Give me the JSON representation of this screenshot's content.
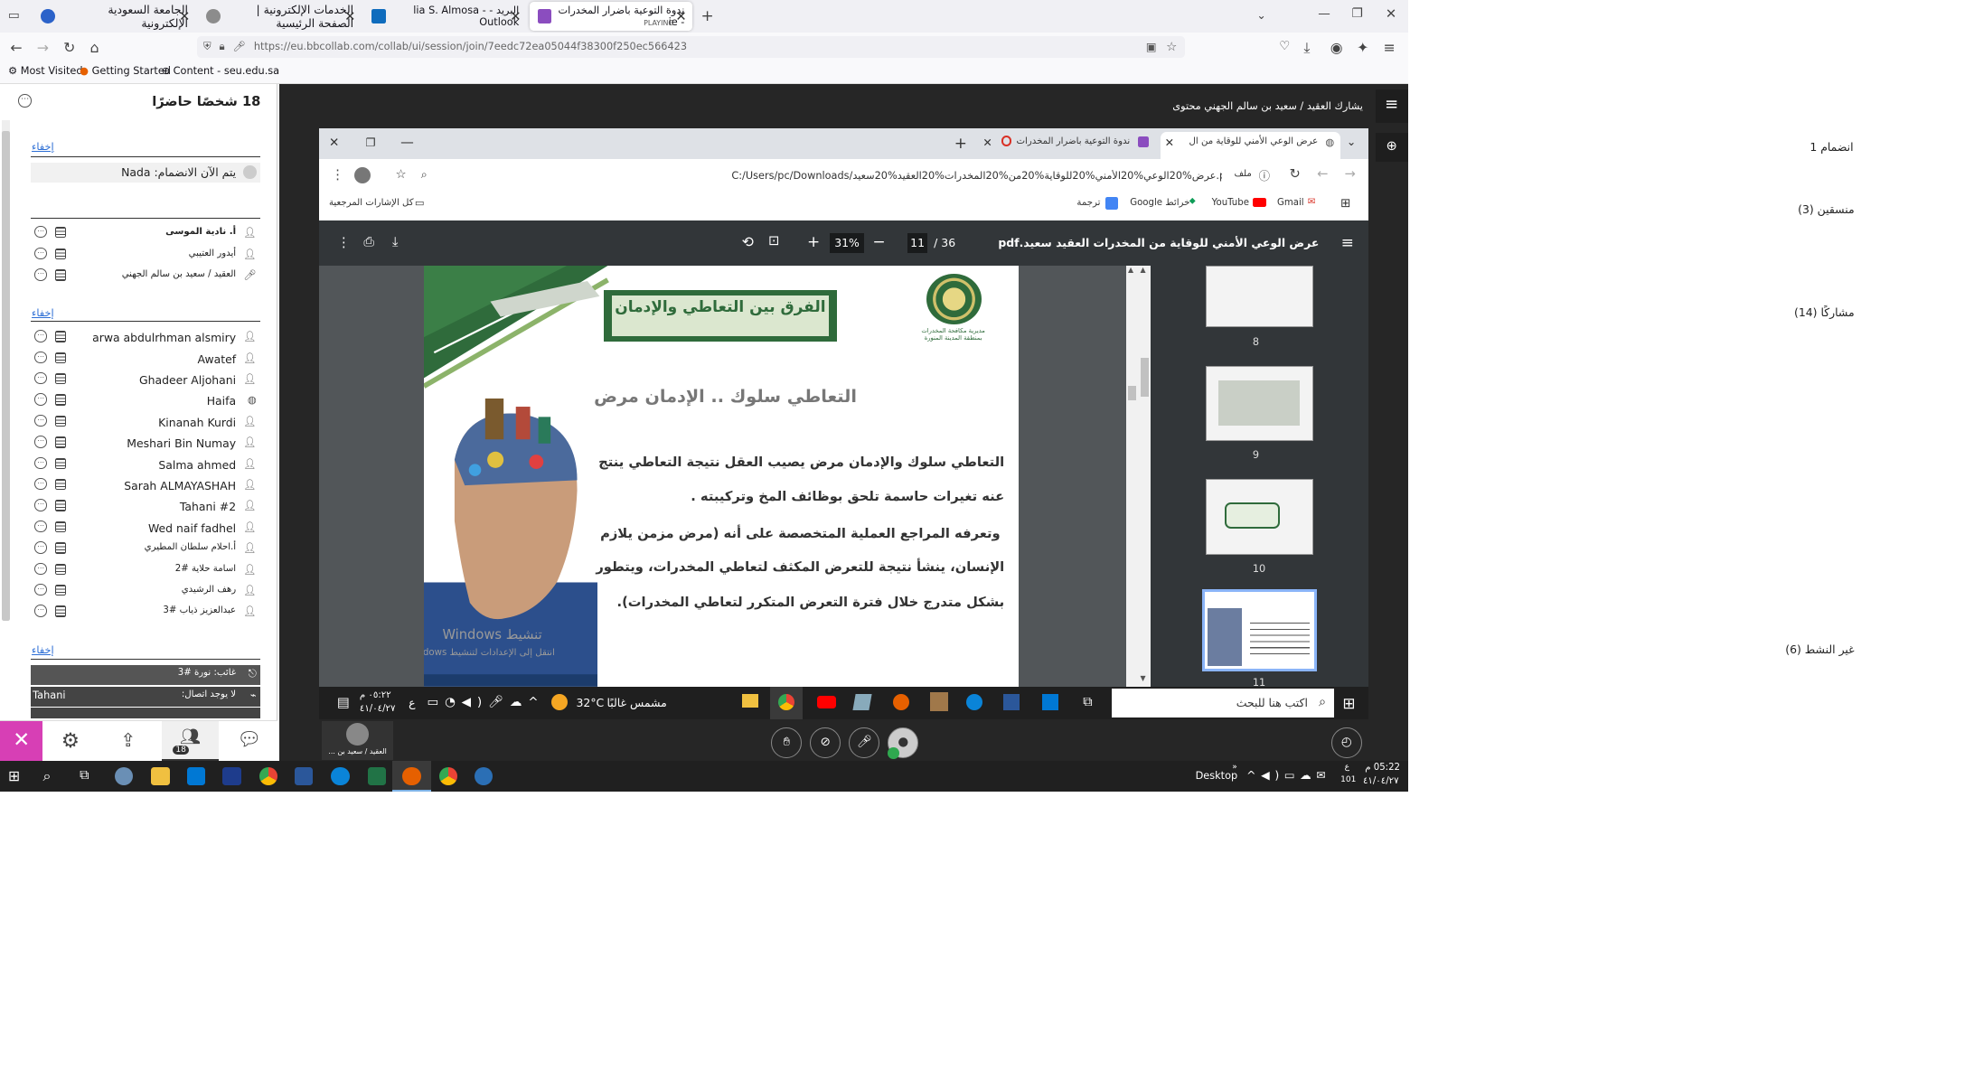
{
  "browser": {
    "tabs": [
      {
        "title": "الجامعة السعودية الإلكترونية",
        "active": false
      },
      {
        "title": "الخدمات الإلكترونية | الصفحة الرئيسية",
        "active": false
      },
      {
        "title": "البريد - lia S. Almosa - Outlook",
        "active": false
      },
      {
        "title": "ندوة التوعية باضرار المخدرات - ie",
        "active": true,
        "sub": "PLAYING"
      }
    ],
    "url": "https://eu.bbcollab.com/collab/ui/session/join/7eedc72ea05044f38300f250ec566423",
    "bookmarks": [
      "Most Visited",
      "Getting Started",
      "Content - seu.edu.sa"
    ]
  },
  "panel": {
    "title": "18 شخصًا حاضرًا",
    "joined": {
      "header": "انضمام 1",
      "hide": "إخفاء",
      "row": "يتم الآن الانضمام:",
      "name": "Nada"
    },
    "presenters": {
      "header": "منسقين (3)",
      "rows": [
        "أ. نادية الموسى",
        "أيدور العتيبي",
        "العقيد / سعيد بن سالم الجهني"
      ]
    },
    "participants": {
      "header": "مشاركًا (14)",
      "hide": "إخفاء",
      "rows": [
        "arwa abdulrhman alsmiry",
        "Awatef",
        "Ghadeer Aljohani",
        "Haifa",
        "Kinanah Kurdi",
        "Meshari Bin Numay",
        "Salma ahmed",
        "Sarah ALMAYASHAH",
        "Tahani #2",
        "Wed naif fadhel",
        "أ.احلام سلطان المطيري",
        "اسامة حلاية #2",
        "رهف الرشيدي",
        "عبدالعزيز ذياب #3"
      ]
    },
    "inactive": {
      "header": "غير النشط (6)",
      "hide": "إخفاء",
      "row1": "غائب: نورة #3",
      "row2_name": "Tahani",
      "row2_status": "لا يوجد اتصال:"
    },
    "badge": "18"
  },
  "stage": {
    "presenter_label": "يشارك العقيد / سعيد بن سالم الجهني محتوى",
    "presenter_thumb": "العقيد / سعيد بن ..."
  },
  "shared_chrome": {
    "tabs": [
      "عرض الوعي الأمني للوقاية من ال",
      "ندوة التوعية باضرار المخدرات"
    ],
    "addr_label": "ملف",
    "path": "C:/Users/pc/Downloads/عرض%20الوعي%20الأمني%20للوقاية%20من%20المخدرات%20العقيد%20سعيد.pdf",
    "bookmarks": [
      "كل الإشارات المرجعية",
      "ترجمة",
      "خرائط Google",
      "YouTube",
      "Gmail"
    ]
  },
  "pdf": {
    "filename": "عرض الوعي الأمني للوقاية من المخدرات العقيد سعيد.pdf",
    "page": "11",
    "total": "/ 36",
    "zoom": "31%",
    "thumb_labels": [
      "8",
      "9",
      "10",
      "11"
    ]
  },
  "slide": {
    "banner": "الفرق بين التعاطي والإدمان",
    "org": "مديرية مكافحة المخدرات بمنطقة المدينة المنورة",
    "heading": "التعاطي سلوك .. الإدمان مرض",
    "lines": [
      "التعاطي سلوك والإدمان مرض يصيب العقل نتيجة التعاطي ينتج",
      "عنه تغيرات حاسمة تلحق بوظائف المخ وتركيبته .",
      "وتعرفه المراجع العملية المتخصصة على أنه (مرض مزمن يلازم",
      "الإنسان، ينشأ نتيجة للتعرض المكثف لتعاطي المخدرات، ويتطور",
      "بشكل متدرج خلال فترة التعرض المتكرر لتعاطي المخدرات)."
    ],
    "watermark1": "تنشيط Windows",
    "watermark2": "انتقل إلى الإعدادات لتنشيط Windows."
  },
  "inner_taskbar": {
    "search": "اكتب هنا للبحث",
    "weather": "32°C",
    "weather_text": "مشمس غالبًا",
    "time": "٠٥:٢٢ م",
    "date": "٤١/٠٤/٢٧",
    "lang": "ع"
  },
  "taskbar": {
    "desktop": "Desktop",
    "time": "05:22 م",
    "date": "٤١/٠٤/٢٧",
    "lang": "ع",
    "num": "101"
  }
}
